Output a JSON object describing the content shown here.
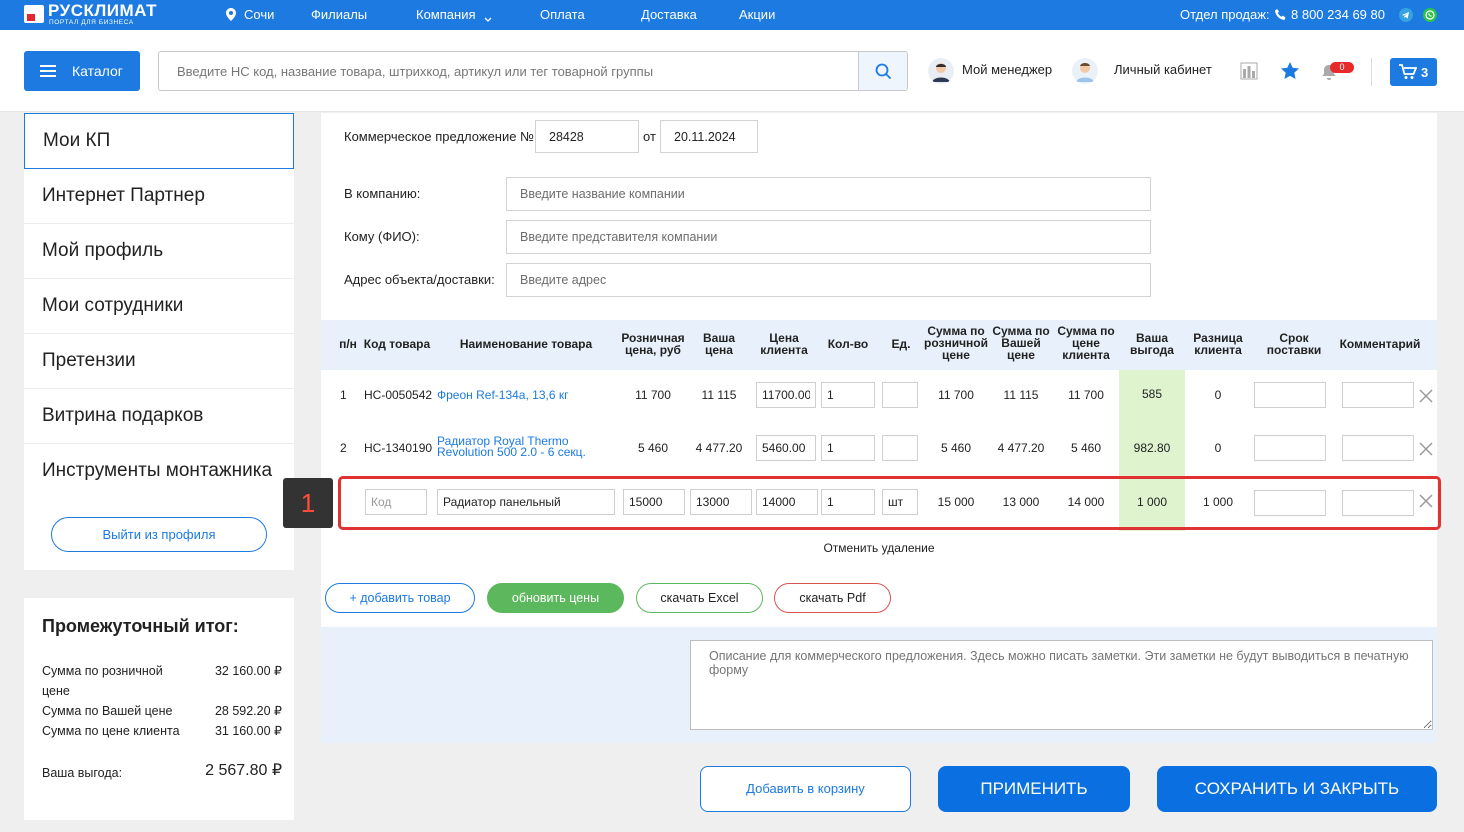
{
  "topbar": {
    "logo_name": "РУСКЛИМАТ",
    "logo_sub": "ПОРТАЛ ДЛЯ БИЗНЕСА",
    "city": "Сочи",
    "nav": [
      "Филиалы",
      "Компания",
      "Оплата",
      "Доставка",
      "Акции"
    ],
    "sales_label": "Отдел продаж:",
    "phone": "8 800 234 69 80"
  },
  "header": {
    "catalog_label": "Каталог",
    "search_placeholder": "Введите НС код, название товара, штрихкод, артикул или тег товарной группы",
    "manager_label": "Мой менеджер",
    "account_label": "Личный кабинет",
    "notif_count": "0",
    "cart_count": "3"
  },
  "sidebar": {
    "items": [
      "Мои КП",
      "Интернет Партнер",
      "Мой профиль",
      "Мои сотрудники",
      "Претензии",
      "Витрина подарков",
      "Инструменты монтажника"
    ],
    "logout_label": "Выйти из профиля"
  },
  "subtotal": {
    "title": "Промежуточный итог:",
    "rows": [
      {
        "label": "Сумма по розничной цене",
        "value": "32 160.00 ₽"
      },
      {
        "label": "Сумма по Вашей цене",
        "value": "28 592.20 ₽"
      },
      {
        "label": "Сумма по цене клиента",
        "value": "31 160.00 ₽"
      }
    ],
    "benefit_label": "Ваша выгода:",
    "benefit_value": "2 567.80 ₽"
  },
  "form": {
    "offer_label": "Коммерческое предложение №",
    "offer_number": "28428",
    "from_label": "от",
    "offer_date": "20.11.2024",
    "company_label": "В компанию:",
    "company_placeholder": "Введите название компании",
    "to_label": "Кому (ФИО):",
    "to_placeholder": "Введите представителя компании",
    "address_label": "Адрес объекта/доставки:",
    "address_placeholder": "Введите адрес"
  },
  "table": {
    "headers": {
      "num": "п/н",
      "code": "Код товара",
      "name": "Наименование товара",
      "retail_1": "Розничная",
      "retail_2": "цена, руб",
      "your_1": "Ваша",
      "your_2": "цена",
      "client_1": "Цена",
      "client_2": "клиента",
      "qty": "Кол-во",
      "unit": "Ед.",
      "sr_1": "Сумма по",
      "sr_2": "розничной",
      "sr_3": "цене",
      "sy_1": "Сумма по",
      "sy_2": "Вашей",
      "sy_3": "цене",
      "sc_1": "Сумма по",
      "sc_2": "цене",
      "sc_3": "клиента",
      "ben_1": "Ваша",
      "ben_2": "выгода",
      "diff_1": "Разница",
      "diff_2": "клиента",
      "term_1": "Срок",
      "term_2": "поставки",
      "comment": "Комментарий"
    },
    "rows": [
      {
        "num": "1",
        "code": "НС-0050542",
        "name_1": "Фреон Ref-134a, 13,6 кг",
        "name_2": "",
        "retail": "11 700",
        "your": "11 115",
        "client": "11700.00",
        "qty": "1",
        "unit": "",
        "sum_retail": "11 700",
        "sum_your": "11 115",
        "sum_client": "11 700",
        "benefit": "585",
        "diff": "0"
      },
      {
        "num": "2",
        "code": "НС-1340190",
        "name_1": "Радиатор Royal Thermo",
        "name_2": "Revolution 500 2.0 - 6 секц.",
        "retail": "5 460",
        "your": "4 477.20",
        "client": "5460.00",
        "qty": "1",
        "unit": "",
        "sum_retail": "5 460",
        "sum_your": "4 477.20",
        "sum_client": "5 460",
        "benefit": "982.80",
        "diff": "0"
      }
    ],
    "custom_row": {
      "code_placeholder": "Код",
      "name": "Радиатор панельный",
      "retail": "15000",
      "your": "13000",
      "client": "14000",
      "qty": "1",
      "unit": "шт",
      "sum_retail": "15 000",
      "sum_your": "13 000",
      "sum_client": "14 000",
      "benefit": "1 000",
      "diff": "1 000"
    },
    "undo_label": "Отменить удаление"
  },
  "annotation": {
    "badge": "1"
  },
  "actions": {
    "add_item": "+ добавить товар",
    "update_prices": "обновить цены",
    "excel": "скачать Excel",
    "pdf": "скачать Pdf",
    "desc_placeholder": "Описание для коммерческого предложения. Здесь можно писать заметки. Эти заметки не будут выводиться в печатную форму",
    "add_to_cart": "Добавить в корзину",
    "apply": "ПРИМЕНИТЬ",
    "save_close": "СОХРАНИТЬ И ЗАКРЫТЬ"
  },
  "colors": {
    "accent": "#1c7ae0",
    "green_btn": "#5cb85c",
    "highlight": "#e03232",
    "benefit_bg": "#dff3cf"
  }
}
